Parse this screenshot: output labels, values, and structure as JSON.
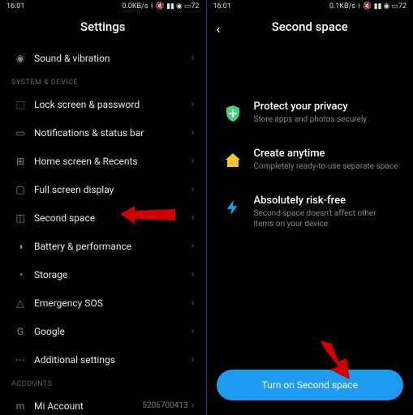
{
  "left": {
    "status": {
      "time": "16:01",
      "net": "0.0KB/s",
      "batt": "72"
    },
    "title": "Settings",
    "sections": {
      "top": [
        {
          "icon": "sound-icon",
          "label": "Sound & vibration"
        }
      ],
      "system_head": "SYSTEM & DEVICE",
      "system": [
        {
          "icon": "lock-icon",
          "label": "Lock screen & password"
        },
        {
          "icon": "notif-icon",
          "label": "Notifications & status bar"
        },
        {
          "icon": "home-screen-icon",
          "label": "Home screen & Recents"
        },
        {
          "icon": "fullscreen-icon",
          "label": "Full screen display"
        },
        {
          "icon": "second-space-icon",
          "label": "Second space"
        },
        {
          "icon": "battery-icon",
          "label": "Battery & performance"
        },
        {
          "icon": "storage-icon",
          "label": "Storage"
        },
        {
          "icon": "emergency-icon",
          "label": "Emergency SOS"
        },
        {
          "icon": "google-icon",
          "label": "Google"
        },
        {
          "icon": "more-icon",
          "label": "Additional settings"
        }
      ],
      "accounts_head": "ACCOUNTS",
      "accounts": [
        {
          "icon": "mi-icon",
          "label": "Mi Account",
          "value": "5206700413"
        }
      ]
    }
  },
  "right": {
    "status": {
      "time": "16:01",
      "net": "0.1KB/s",
      "batt": "72"
    },
    "title": "Second space",
    "features": [
      {
        "icon": "shield-icon",
        "title": "Protect your privacy",
        "sub": "Store apps and photos securely"
      },
      {
        "icon": "home-icon",
        "title": "Create anytime",
        "sub": "Completely ready-to-use separate space"
      },
      {
        "icon": "bolt-icon",
        "title": "Absolutely risk-free",
        "sub": "Second space doesn't affect other items on your device"
      }
    ],
    "button": "Turn on Second space"
  }
}
